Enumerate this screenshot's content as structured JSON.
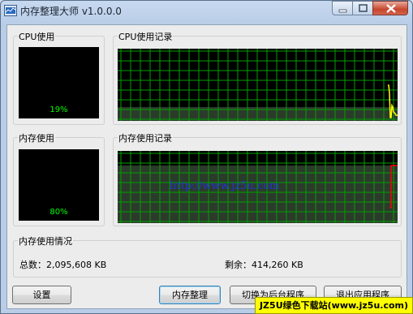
{
  "window": {
    "title": "内存整理大师 v1.0.0.0"
  },
  "cpu": {
    "group_label": "CPU使用",
    "percent_text": "19%",
    "percent": 19
  },
  "cpu_history": {
    "group_label": "CPU使用记录"
  },
  "mem": {
    "group_label": "内存使用",
    "percent_text": "80%",
    "percent": 80
  },
  "mem_history": {
    "group_label": "内存使用记录",
    "watermark": "http://www.jz5u.com"
  },
  "mem_info": {
    "group_label": "内存使用情况",
    "total": "总数：2,095,608 KB",
    "free": "剩余：414,260 KB"
  },
  "buttons": {
    "settings": "设置",
    "optimize": "内存整理",
    "background": "切换为后台程序",
    "exit": "退出应用程序"
  },
  "stamp": "JZ5U绿色下载站(www.jz5u.com)",
  "colors": {
    "grid": "#00a000",
    "cpu_trace": "#ffff00",
    "mem_trace": "#ff0000",
    "meter_text": "#00ff00"
  }
}
